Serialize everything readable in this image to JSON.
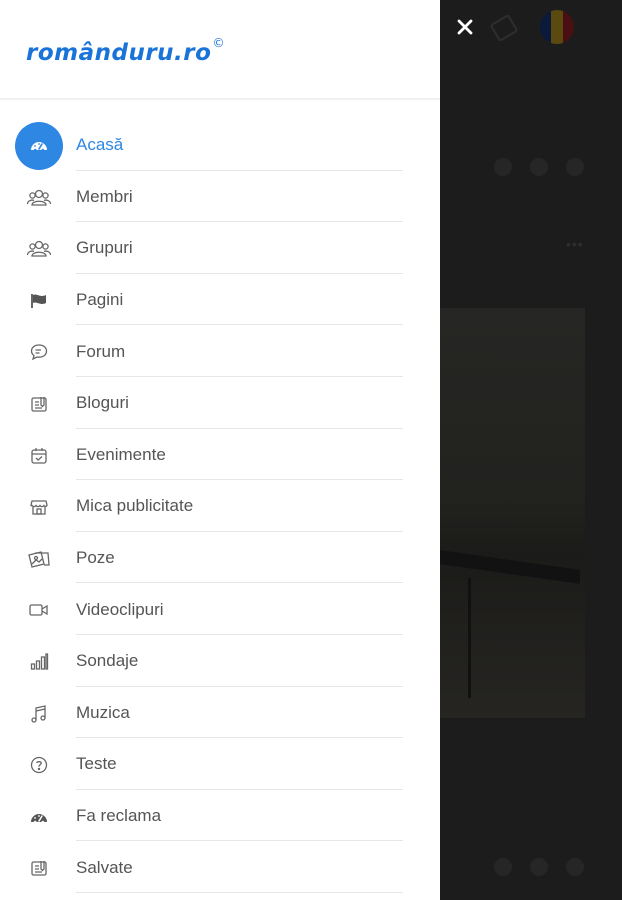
{
  "app": {
    "logo_text": "românduru.ro",
    "logo_mark": "©",
    "brand_color": "#1a73d9",
    "accent_color": "#2d87e3"
  },
  "overlay": {
    "close_icon": "close-icon",
    "close_label": "✕"
  },
  "menu": {
    "items": [
      {
        "label": "Acasă",
        "icon": "dashboard-icon",
        "active": true
      },
      {
        "label": "Membri",
        "icon": "users-icon",
        "active": false
      },
      {
        "label": "Grupuri",
        "icon": "groups-icon",
        "active": false
      },
      {
        "label": "Pagini",
        "icon": "flag-icon",
        "active": false
      },
      {
        "label": "Forum",
        "icon": "chat-icon",
        "active": false
      },
      {
        "label": "Bloguri",
        "icon": "blog-icon",
        "active": false
      },
      {
        "label": "Evenimente",
        "icon": "calendar-icon",
        "active": false
      },
      {
        "label": "Mica publicitate",
        "icon": "store-icon",
        "active": false
      },
      {
        "label": "Poze",
        "icon": "photos-icon",
        "active": false
      },
      {
        "label": "Videoclipuri",
        "icon": "video-icon",
        "active": false
      },
      {
        "label": "Sondaje",
        "icon": "poll-icon",
        "active": false
      },
      {
        "label": "Muzica",
        "icon": "music-icon",
        "active": false
      },
      {
        "label": "Teste",
        "icon": "question-icon",
        "active": false
      },
      {
        "label": "Fa reclama",
        "icon": "ads-icon",
        "active": false
      },
      {
        "label": "Salvate",
        "icon": "saved-icon",
        "active": false
      }
    ]
  }
}
